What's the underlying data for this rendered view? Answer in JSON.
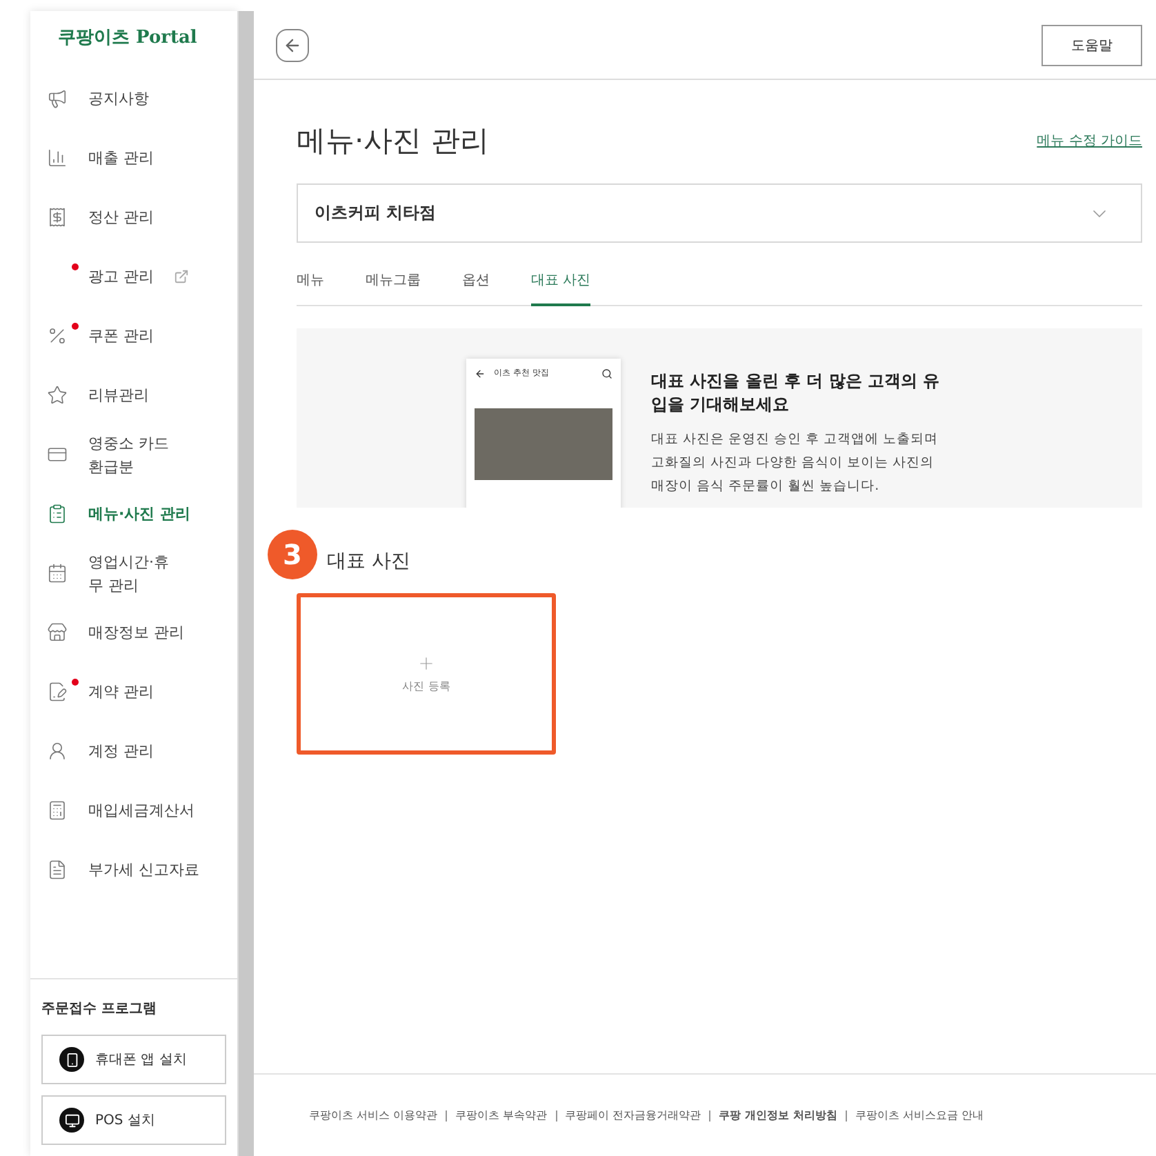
{
  "sidebar": {
    "logo": "쿠팡이츠 Portal",
    "items": [
      {
        "label": "공지사항",
        "selected": false,
        "alert": false,
        "external": false
      },
      {
        "label": "매출 관리",
        "selected": false,
        "alert": false,
        "external": false
      },
      {
        "label": "정산 관리",
        "selected": false,
        "alert": false,
        "external": false
      },
      {
        "label": "광고 관리",
        "selected": false,
        "alert": true,
        "external": true
      },
      {
        "label": "쿠폰 관리",
        "selected": false,
        "alert": true,
        "external": false
      },
      {
        "label": "리뷰관리",
        "selected": false,
        "alert": false,
        "external": false
      },
      {
        "label": "영중소 카드 환급분",
        "selected": false,
        "alert": false,
        "external": false
      },
      {
        "label": "메뉴·사진 관리",
        "selected": true,
        "alert": false,
        "external": false
      },
      {
        "label": "영업시간·휴무 관리",
        "selected": false,
        "alert": false,
        "external": false
      },
      {
        "label": "매장정보 관리",
        "selected": false,
        "alert": false,
        "external": false
      },
      {
        "label": "계약 관리",
        "selected": false,
        "alert": true,
        "external": false
      },
      {
        "label": "계정 관리",
        "selected": false,
        "alert": false,
        "external": false
      },
      {
        "label": "매입세금계산서",
        "selected": false,
        "alert": false,
        "external": false
      },
      {
        "label": "부가세 신고자료",
        "selected": false,
        "alert": false,
        "external": false
      }
    ],
    "program_title": "주문접수 프로그램",
    "program_buttons": [
      "휴대폰 앱 설치",
      "POS 설치"
    ]
  },
  "header": {
    "help_button": "도움말"
  },
  "page": {
    "title": "메뉴·사진 관리",
    "guide_link": "메뉴 수정 가이드",
    "store_select": "이츠커피 치타점",
    "tabs": [
      {
        "label": "메뉴",
        "selected": false
      },
      {
        "label": "메뉴그룹",
        "selected": false
      },
      {
        "label": "옵션",
        "selected": false
      },
      {
        "label": "대표 사진",
        "selected": true
      }
    ],
    "promo": {
      "phone_title": "이츠 추천 맛집",
      "heading": "대표 사진을 올린 후 더 많은 고객의 유입을 기대해보세요",
      "body": "대표 사진은 운영진 승인 후 고객앱에 노출되며 고화질의 사진과 다양한 음식이 보이는 사진의 매장이 음식 주문률이 훨씬 높습니다."
    },
    "section_title": "대표 사진",
    "upload_label": "사진 등록",
    "annotation_number": "3"
  },
  "footer": {
    "links": [
      {
        "label": "쿠팡이츠 서비스 이용약관",
        "bold": false
      },
      {
        "label": "쿠팡이츠 부속약관",
        "bold": false
      },
      {
        "label": "쿠팡페이 전자금융거래약관",
        "bold": false
      },
      {
        "label": "쿠팡 개인정보 처리방침",
        "bold": true
      },
      {
        "label": "쿠팡이츠 서비스요금 안내",
        "bold": false
      }
    ]
  }
}
